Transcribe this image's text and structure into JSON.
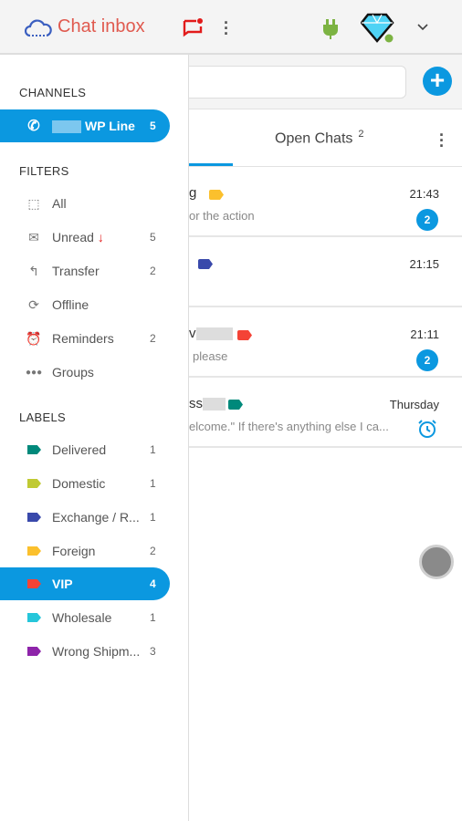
{
  "header": {
    "app_title": "Chat inbox",
    "icons": [
      "cloud-logo-icon",
      "chat-alert-icon",
      "more-vert-icon",
      "plug-icon",
      "diamond-icon",
      "chevron-down-icon"
    ]
  },
  "toolbar": {
    "search_placeholder": "",
    "add_icon": "plus-icon"
  },
  "tabs": {
    "open_chats_label": "Open Chats",
    "open_chats_count": "2"
  },
  "chats": [
    {
      "name": "g",
      "preview": "or the action",
      "time": "21:43",
      "unread": "2",
      "tag_color": "#fbc02d"
    },
    {
      "name": "",
      "preview": "",
      "time": "21:15",
      "unread": "",
      "tag_color": "#3949ab"
    },
    {
      "name": "v",
      "preview": "please",
      "time": "21:11",
      "unread": "2",
      "tag_color": "#f44336"
    },
    {
      "name": "ss",
      "preview": "elcome.\" If there's anything else I ca...",
      "time": "Thursday",
      "reminder": true,
      "tag_color": "#00897b"
    }
  ],
  "sidebar": {
    "channels_title": "CHANNELS",
    "channel": {
      "label": "WP Line",
      "count": "5",
      "icon": "whatsapp-icon"
    },
    "filters_title": "FILTERS",
    "filters": [
      {
        "label": "All",
        "count": "",
        "icon": "all-icon"
      },
      {
        "label": "Unread",
        "count": "5",
        "icon": "mail-icon"
      },
      {
        "label": "Transfer",
        "count": "2",
        "icon": "reply-icon"
      },
      {
        "label": "Offline",
        "count": "",
        "icon": "sync-icon"
      },
      {
        "label": "Reminders",
        "count": "2",
        "icon": "alarm-icon"
      },
      {
        "label": "Groups",
        "count": "",
        "icon": "groups-icon"
      }
    ],
    "labels_title": "LABELS",
    "labels": [
      {
        "label": "Delivered",
        "count": "1",
        "color": "#00897b"
      },
      {
        "label": "Domestic",
        "count": "1",
        "color": "#c0ca33"
      },
      {
        "label": "Exchange / R...",
        "count": "1",
        "color": "#3949ab"
      },
      {
        "label": "Foreign",
        "count": "2",
        "color": "#fbc02d"
      },
      {
        "label": "VIP",
        "count": "4",
        "color": "#f44336",
        "active": true
      },
      {
        "label": "Wholesale",
        "count": "1",
        "color": "#26c6da"
      },
      {
        "label": "Wrong Shipm...",
        "count": "3",
        "color": "#8e24aa"
      }
    ]
  },
  "colors": {
    "accent": "#0b98e0",
    "brand": "#e05a4f"
  }
}
